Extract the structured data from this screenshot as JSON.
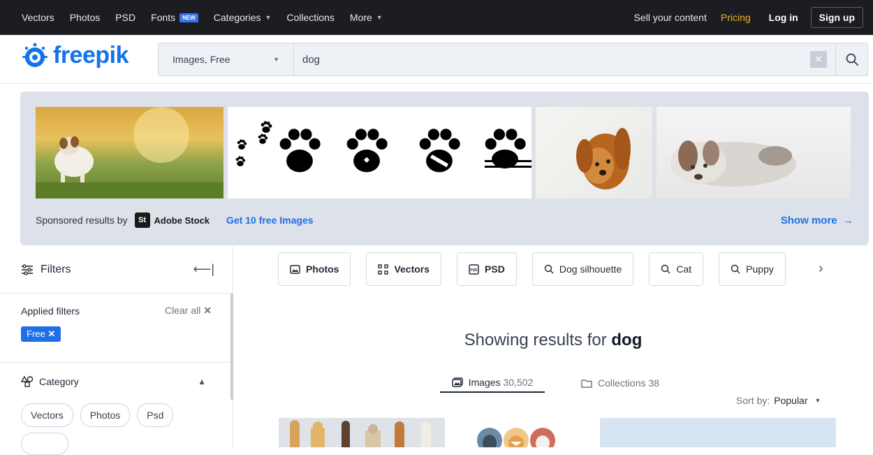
{
  "colors": {
    "brand": "#1273eb",
    "link": "#1f6fe8",
    "pricing": "#f5b423",
    "topbar": "#1c1d22"
  },
  "topnav": {
    "items": [
      "Vectors",
      "Photos",
      "PSD",
      "Fonts",
      "Categories",
      "Collections",
      "More"
    ],
    "new_badge": "NEW",
    "sell": "Sell your content",
    "pricing": "Pricing",
    "login": "Log in",
    "signup": "Sign up"
  },
  "header": {
    "logo_text": "freepik",
    "scope": "Images, Free",
    "query": "dog"
  },
  "sponsored": {
    "label": "Sponsored results by",
    "st_logo": "St",
    "provider": "Adobe Stock",
    "get_free": "Get 10 free Images",
    "show_more": "Show more",
    "arrow": "→"
  },
  "sidebar": {
    "filters": "Filters",
    "applied": "Applied filters",
    "clear_all": "Clear all",
    "free_chip": "Free",
    "category": "Category",
    "category_chips": [
      "Vectors",
      "Photos",
      "Psd"
    ]
  },
  "pills": [
    {
      "label": "Photos",
      "icon": "image-icon"
    },
    {
      "label": "Vectors",
      "icon": "vector-icon"
    },
    {
      "label": "PSD",
      "icon": "psd-icon"
    },
    {
      "label": "Dog silhouette",
      "icon": "search-icon"
    },
    {
      "label": "Cat",
      "icon": "search-icon"
    },
    {
      "label": "Puppy",
      "icon": "search-icon"
    }
  ],
  "showing": {
    "prefix": "Showing results for",
    "term": "dog"
  },
  "tabs": {
    "images": {
      "label": "Images",
      "count": "30,502"
    },
    "collections": {
      "label": "Collections",
      "count": "38"
    }
  },
  "sort": {
    "label": "Sort by:",
    "value": "Popular"
  }
}
